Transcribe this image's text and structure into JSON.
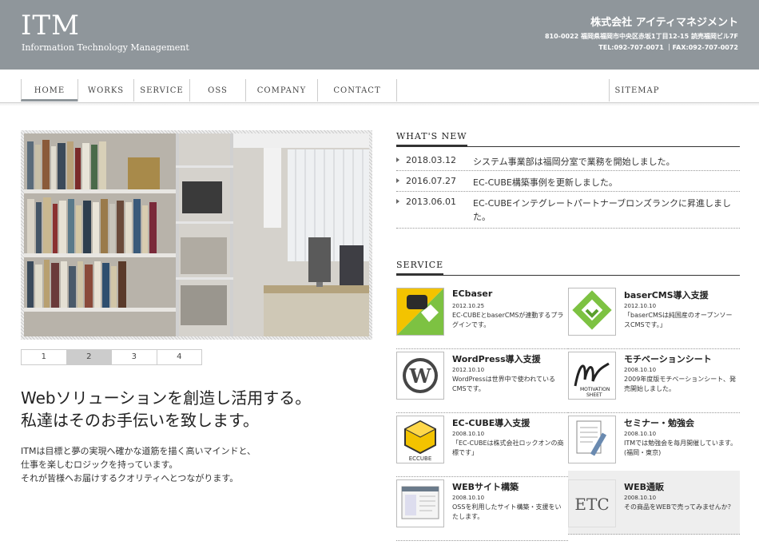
{
  "header": {
    "logo": "ITM",
    "logo_sub": "Information Technology Management",
    "company": "株式会社 アイティマネジメント",
    "address": "810-0022 福岡県福岡市中央区赤坂1丁目12-15 読売福岡ビル7F",
    "tel": "TEL:092-707-0071 ｜FAX:092-707-0072"
  },
  "nav": {
    "home": "HOME",
    "works": "WORKS",
    "service": "SERVICE",
    "oss": "OSS",
    "company": "COMPANY",
    "contact": "CONTACT",
    "sitemap": "SITEMAP"
  },
  "slideshow": {
    "pages": [
      "1",
      "2",
      "3",
      "4"
    ],
    "current": 2
  },
  "lead": {
    "line1": "Webソリューションを創造し活用する。",
    "line2": "私達はそのお手伝いを致します。"
  },
  "body": {
    "line1": "ITMは目標と夢の実現へ確かな道筋を描く高いマインドと、",
    "line2": "仕事を楽しむロジックを持っています。",
    "line3": "それが皆様へお届けするクオリティへとつながります。"
  },
  "whats_new": {
    "heading": "WHAT'S NEW",
    "items": [
      {
        "date": "2018.03.12",
        "text": "システム事業部は福岡分室で業務を開始しました。"
      },
      {
        "date": "2016.07.27",
        "text": "EC-CUBE構築事例を更新しました。"
      },
      {
        "date": "2013.06.01",
        "text": "EC-CUBEインテグレートパートナーブロンズランクに昇進しました。"
      }
    ]
  },
  "service": {
    "heading": "SERVICE",
    "items": [
      {
        "title": "ECbaser",
        "date": "2012.10.25",
        "desc": "EC-CUBEとbaserCMSが連動するプラグインです。",
        "icon": "ecbaser-logo-icon"
      },
      {
        "title": "baserCMS導入支援",
        "date": "2012.10.10",
        "desc": "「baserCMSは純国産のオープンソースCMSです。」",
        "icon": "basercms-logo-icon"
      },
      {
        "title": "WordPress導入支援",
        "date": "2012.10.10",
        "desc": "WordPressは世界中で使われているCMSです。",
        "icon": "wordpress-logo-icon"
      },
      {
        "title": "モチベーションシート",
        "date": "2008.10.10",
        "desc": "2009年度版モチベーションシート、発売開始しました。",
        "icon": "motivation-sheet-icon"
      },
      {
        "title": "EC-CUBE導入支援",
        "date": "2008.10.10",
        "desc": "「EC-CUBEは株式会社ロックオンの商標です」",
        "icon": "eccube-logo-icon"
      },
      {
        "title": "セミナー・勉強会",
        "date": "2008.10.10",
        "desc": "ITMでは勉強会を毎月開催しています。(福岡・東京)",
        "icon": "seminar-document-icon"
      },
      {
        "title": "WEBサイト構築",
        "date": "2008.10.10",
        "desc": "OSSを利用したサイト構築・支援をいたします。",
        "icon": "website-screenshot-icon"
      },
      {
        "title": "WEB通販",
        "date": "2008.10.10",
        "desc": "その商品をWEBで売ってみませんか？",
        "icon": "etc-icon",
        "icon_text": "ETC"
      }
    ]
  },
  "colors": {
    "header_bg": "#8f969b",
    "accent_text": "#ffffff"
  }
}
